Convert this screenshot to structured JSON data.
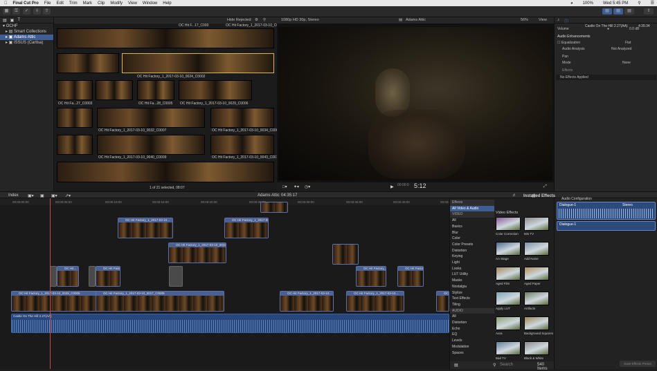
{
  "menubar": {
    "app": "Final Cut Pro",
    "items": [
      "File",
      "Edit",
      "Trim",
      "Mark",
      "Clip",
      "Modify",
      "View",
      "Window",
      "Help"
    ],
    "clock": "Wed 5:45 PM",
    "battery": "100%"
  },
  "sidebar": {
    "library": "OCHF",
    "items": [
      "Smart Collections",
      "Adams Attic",
      "ISSUS (Carlisa)"
    ]
  },
  "browser": {
    "filter": "Hide Rejected",
    "top_label": "OC Hit F...17_C000",
    "top_label2": "OC Hit Factory_1_2017-03-10_C00",
    "labels": [
      "OC Hit Factory_1_2017-03-10_0024_C0002",
      "OC Hit Fa...27_C0003",
      "OC Hit Fa...28_C0005",
      "OC Hit Factory_1_2017-03-10_0029_C0006",
      "OC Hit Factory_1_2017-03-10_0032_C0007",
      "OC Hit Factory_1_2017-03-10_0034_C0008",
      "OC Hit Factory_1_2017-03-10_0040_C0009",
      "OC Hit Factory_1_2017-03-10_0043_C0010"
    ],
    "status": "1 of 21 selected, 08:07"
  },
  "viewer": {
    "format": "1080p HD 30p, Stereo",
    "title": "Adams Attic",
    "zoom": "56%",
    "view_menu": "View",
    "timecode": "5:12"
  },
  "inspector": {
    "title": "Castle On The Hill 2.27(AA)",
    "duration": "4:35:34",
    "volume_label": "Volume",
    "volume_value": "0.0 dB",
    "enhancements": "Audio Enhancements",
    "equalization": "Equalization",
    "eq_value": "Flat",
    "analysis": "Audio Analysis",
    "analysis_value": "Not Analyzed",
    "pan": "Pan",
    "mode": "Mode",
    "mode_value": "None",
    "effects": "Effects",
    "no_effects": "No Effects Applied"
  },
  "timeline_bar": {
    "index": "Index",
    "project": "Adams Attic",
    "duration": "04:35:17",
    "installed": "Installed Effects"
  },
  "timeline": {
    "ruler": [
      "00:00:00:00",
      "00:00:05:00",
      "00:00:10:00",
      "00:00:15:00",
      "00:00:20:00",
      "00:00:25:00",
      "00:00:30:00",
      "00:00:35:00",
      "00:00:40:00",
      "00:00:45:00",
      "00:00:50:00"
    ],
    "clip_labels": {
      "a1": "OC Hit Factory_1_2017-03-10...",
      "a2": "OC Hit Factory_1_2017-03-10...",
      "b1": "OC Hit Factory_1_2017-03-10_00(45...",
      "c1": "OC Hit...",
      "c2": "OC Hit Factory...",
      "c3": "OC Hit Factory_1_2017-03-10...",
      "c4": "OC Hit Factory_1_2...",
      "c5": "OC Hit Fac...",
      "m1": "OC Hit Factory_1_2017-03-10_0028_C0005",
      "m2": "OC Hit Factory_1_2017-03-10_0017_C0009",
      "m3": "OC Hit Factory_1_2017-03-10...",
      "m4": "OC Hit Factory_1_2017-03-10...",
      "m5": "OC Hit Factory_1_2017..."
    },
    "audio_label": "Castle On The Hill 2.27(AA)"
  },
  "effects": {
    "categories": [
      {
        "label": "Effects",
        "type": "sec"
      },
      {
        "label": "All Video & Audio",
        "type": "sel"
      },
      {
        "label": "VIDEO",
        "type": "sec"
      },
      {
        "label": "All",
        "type": ""
      },
      {
        "label": "Basics",
        "type": ""
      },
      {
        "label": "Blur",
        "type": ""
      },
      {
        "label": "Color",
        "type": ""
      },
      {
        "label": "Color Presets",
        "type": ""
      },
      {
        "label": "Distortion",
        "type": ""
      },
      {
        "label": "Keying",
        "type": ""
      },
      {
        "label": "Light",
        "type": ""
      },
      {
        "label": "Looks",
        "type": ""
      },
      {
        "label": "LUT Utility",
        "type": ""
      },
      {
        "label": "Masks",
        "type": ""
      },
      {
        "label": "Nostalgia",
        "type": ""
      },
      {
        "label": "Stylize",
        "type": ""
      },
      {
        "label": "Text Effects",
        "type": ""
      },
      {
        "label": "Tiling",
        "type": ""
      },
      {
        "label": "AUDIO",
        "type": "sec"
      },
      {
        "label": "All",
        "type": ""
      },
      {
        "label": "Distortion",
        "type": ""
      },
      {
        "label": "Echo",
        "type": ""
      },
      {
        "label": "EQ",
        "type": ""
      },
      {
        "label": "Levels",
        "type": ""
      },
      {
        "label": "Modulation",
        "type": ""
      },
      {
        "label": "Spaces",
        "type": ""
      }
    ],
    "header": "Video Effects",
    "tiles": [
      {
        "label": "Color Correction",
        "color": "#8a5c9c"
      },
      {
        "label": "50s TV",
        "color": "#8c8c8c"
      },
      {
        "label": "AA Stage",
        "color": "#4a6a90"
      },
      {
        "label": "Add Noise",
        "color": "#7b90a8"
      },
      {
        "label": "Aged Film",
        "color": "#a58a5a"
      },
      {
        "label": "Aged Paper",
        "color": "#b0905a"
      },
      {
        "label": "Apply LUT",
        "color": "#7aa6b0"
      },
      {
        "label": "Artifacts",
        "color": "#6c7d5a"
      },
      {
        "label": "Aura",
        "color": "#8aa070"
      },
      {
        "label": "Background Squares",
        "color": "#9a8a50"
      },
      {
        "label": "Bad TV",
        "color": "#5e7e9a"
      },
      {
        "label": "Black & White",
        "color": "#8a8a8a"
      }
    ],
    "search_placeholder": "Search",
    "count": "540 Items"
  },
  "audio_inspector": {
    "header": "Audio Configuration",
    "role1": "Dialogue-1",
    "role1_value": "Stereo",
    "role2": "Dialogue-1",
    "save_button": "Save Effects Preset"
  }
}
